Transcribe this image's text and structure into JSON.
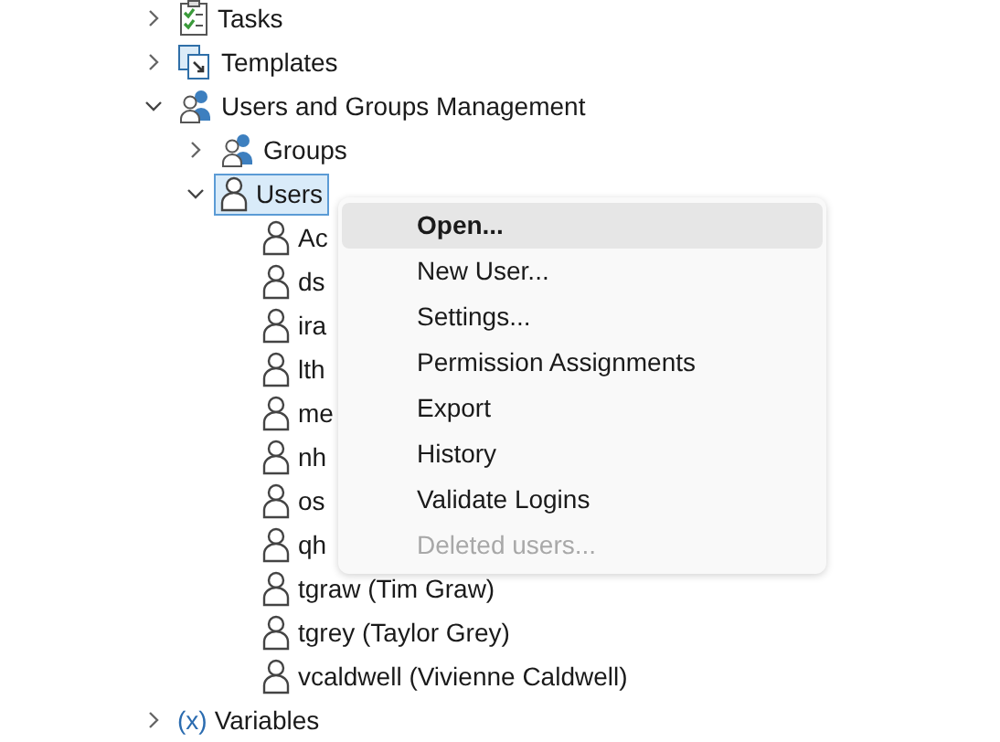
{
  "tree": [
    {
      "label": "Tasks",
      "kind": "tasks",
      "expanded": false,
      "selected": false
    },
    {
      "label": "Templates",
      "kind": "templates",
      "expanded": false,
      "selected": false
    },
    {
      "label": "Users and Groups Management",
      "kind": "group",
      "expanded": true,
      "selected": false,
      "children": [
        {
          "label": "Groups",
          "kind": "group",
          "expanded": false,
          "selected": false
        },
        {
          "label": "Users",
          "kind": "user",
          "expanded": true,
          "selected": true,
          "children": [
            {
              "label": "Ac",
              "kind": "user",
              "selected": false
            },
            {
              "label": "ds",
              "kind": "user",
              "selected": false
            },
            {
              "label": "ira",
              "kind": "user",
              "selected": false
            },
            {
              "label": "lth",
              "kind": "user",
              "selected": false
            },
            {
              "label": "me",
              "kind": "user",
              "selected": false
            },
            {
              "label": "nh",
              "kind": "user",
              "selected": false
            },
            {
              "label": "os",
              "kind": "user",
              "selected": false
            },
            {
              "label": "qh",
              "kind": "user",
              "selected": false
            },
            {
              "label": "tgraw (Tim Graw)",
              "kind": "user",
              "selected": false
            },
            {
              "label": "tgrey (Taylor Grey)",
              "kind": "user",
              "selected": false
            },
            {
              "label": "vcaldwell (Vivienne Caldwell)",
              "kind": "user",
              "selected": false
            }
          ]
        }
      ]
    },
    {
      "label": "Variables",
      "kind": "text",
      "icon_text": "(x)",
      "expanded": false,
      "selected": false
    }
  ],
  "context_menu": {
    "items": [
      {
        "label": "Open...",
        "default": true,
        "selected": true,
        "disabled": false
      },
      {
        "label": "New User...",
        "default": false,
        "selected": false,
        "disabled": false
      },
      {
        "label": "Settings...",
        "default": false,
        "selected": false,
        "disabled": false
      },
      {
        "label": "Permission Assignments",
        "default": false,
        "selected": false,
        "disabled": false
      },
      {
        "label": "Export",
        "default": false,
        "selected": false,
        "disabled": false
      },
      {
        "label": "History",
        "default": false,
        "selected": false,
        "disabled": false
      },
      {
        "label": "Validate Logins",
        "default": false,
        "selected": false,
        "disabled": false
      },
      {
        "label": "Deleted users...",
        "default": false,
        "selected": false,
        "disabled": true
      }
    ]
  }
}
